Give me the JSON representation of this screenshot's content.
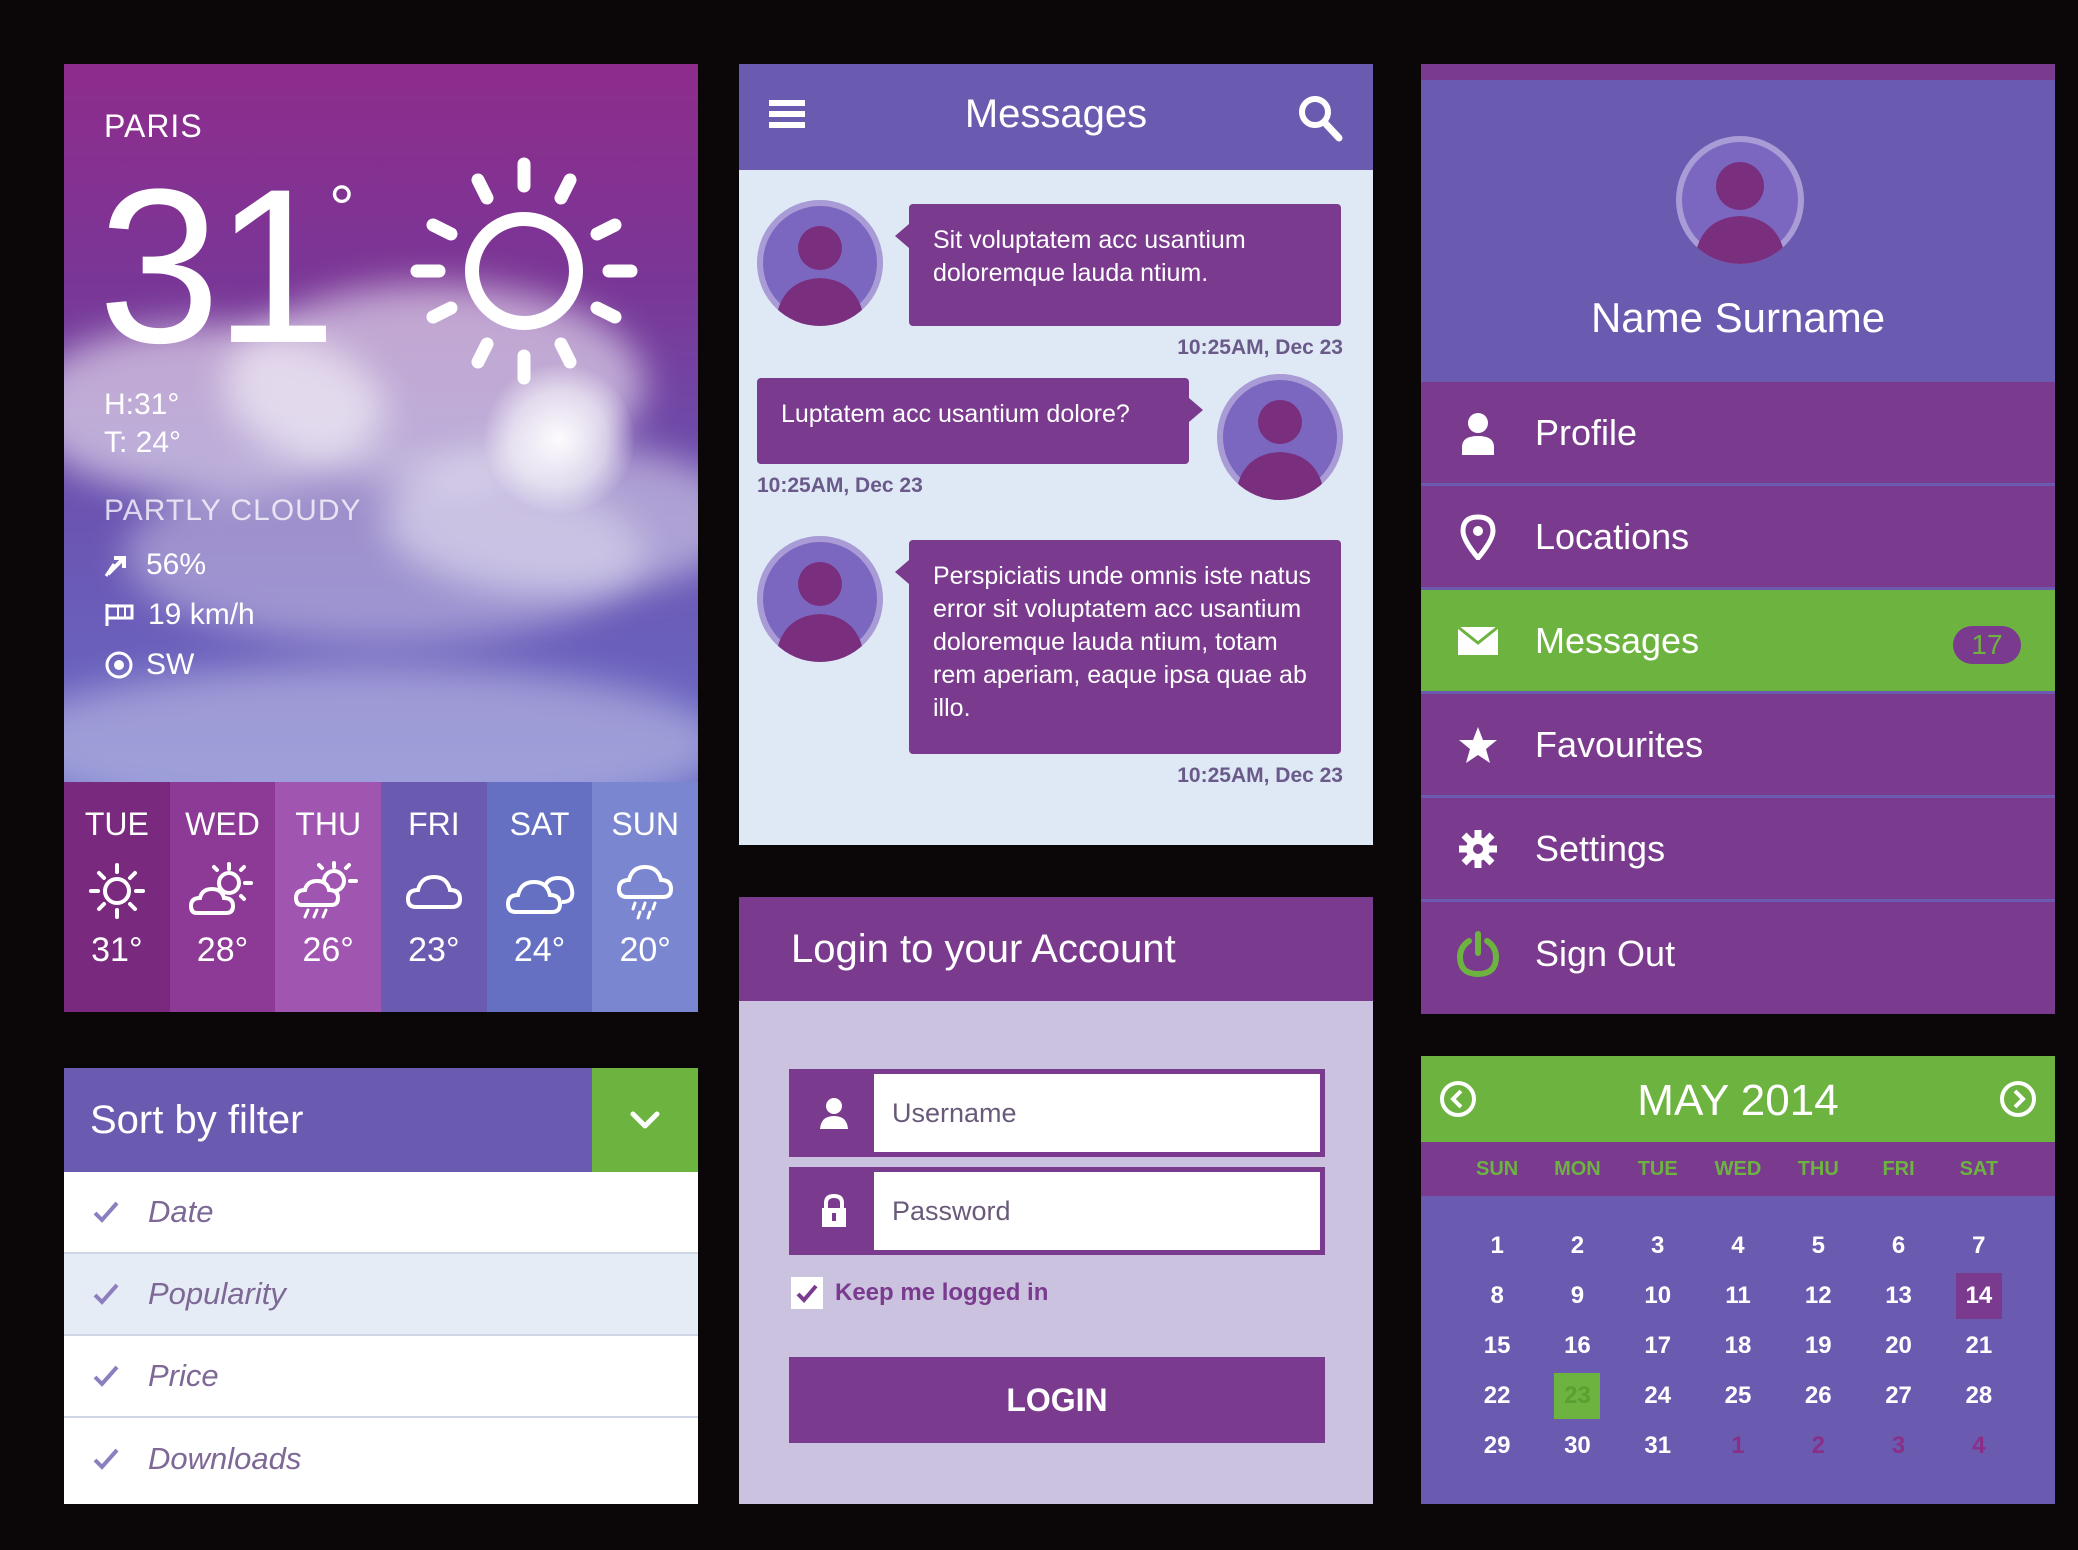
{
  "colors": {
    "purple": "#7a3a8e",
    "violet": "#6b5bb0",
    "green": "#6db33f",
    "light": "#dfe8f5"
  },
  "weather": {
    "city": "PARIS",
    "temp": "31",
    "degree": "°",
    "high": "H:31°",
    "feel": "T: 24°",
    "condition": "PARTLY CLOUDY",
    "humidity": "56%",
    "wind": "19 km/h",
    "direction": "SW",
    "days": [
      {
        "name": "TUE",
        "temp": "31°",
        "icon": "sun-icon"
      },
      {
        "name": "WED",
        "temp": "28°",
        "icon": "sun-cloud-icon"
      },
      {
        "name": "THU",
        "temp": "26°",
        "icon": "sun-cloud-rain-icon"
      },
      {
        "name": "FRI",
        "temp": "23°",
        "icon": "cloud-icon"
      },
      {
        "name": "SAT",
        "temp": "24°",
        "icon": "clouds-icon"
      },
      {
        "name": "SUN",
        "temp": "20°",
        "icon": "rain-icon"
      }
    ]
  },
  "sort": {
    "title": "Sort by filter",
    "items": [
      "Date",
      "Popularity",
      "Price",
      "Downloads"
    ]
  },
  "messages": {
    "title": "Messages",
    "items": [
      {
        "text": "Sit voluptatem acc usantium doloremque lauda ntium.",
        "time": "10:25AM, Dec 23",
        "side": "right"
      },
      {
        "text": "Luptatem acc usantium dolore?",
        "time": "10:25AM, Dec 23",
        "side": "left"
      },
      {
        "text": "Perspiciatis unde omnis iste natus error sit voluptatem acc usantium doloremque lauda ntium, totam rem aperiam, eaque ipsa quae ab illo.",
        "time": "10:25AM, Dec 23",
        "side": "right"
      }
    ]
  },
  "login": {
    "title": "Login to your Account",
    "username_placeholder": "Username",
    "password_placeholder": "Password",
    "keep": "Keep me logged in",
    "button": "LOGIN"
  },
  "profile": {
    "name": "Name Surname",
    "menu": [
      {
        "label": "Profile",
        "icon": "user-icon"
      },
      {
        "label": "Locations",
        "icon": "location-pin-icon"
      },
      {
        "label": "Messages",
        "icon": "envelope-icon",
        "badge": "17"
      },
      {
        "label": "Favourites",
        "icon": "star-icon"
      },
      {
        "label": "Settings",
        "icon": "gear-icon"
      },
      {
        "label": "Sign Out",
        "icon": "power-icon"
      }
    ]
  },
  "calendar": {
    "title": "MAY 2014",
    "dows": [
      "SUN",
      "MON",
      "TUE",
      "WED",
      "THU",
      "FRI",
      "SAT"
    ],
    "days": [
      "1",
      "2",
      "3",
      "4",
      "5",
      "6",
      "7",
      "8",
      "9",
      "10",
      "11",
      "12",
      "13",
      "14",
      "15",
      "16",
      "17",
      "18",
      "19",
      "20",
      "21",
      "22",
      "23",
      "24",
      "25",
      "26",
      "27",
      "28",
      "29",
      "30",
      "31",
      "1",
      "2",
      "3",
      "4"
    ]
  }
}
